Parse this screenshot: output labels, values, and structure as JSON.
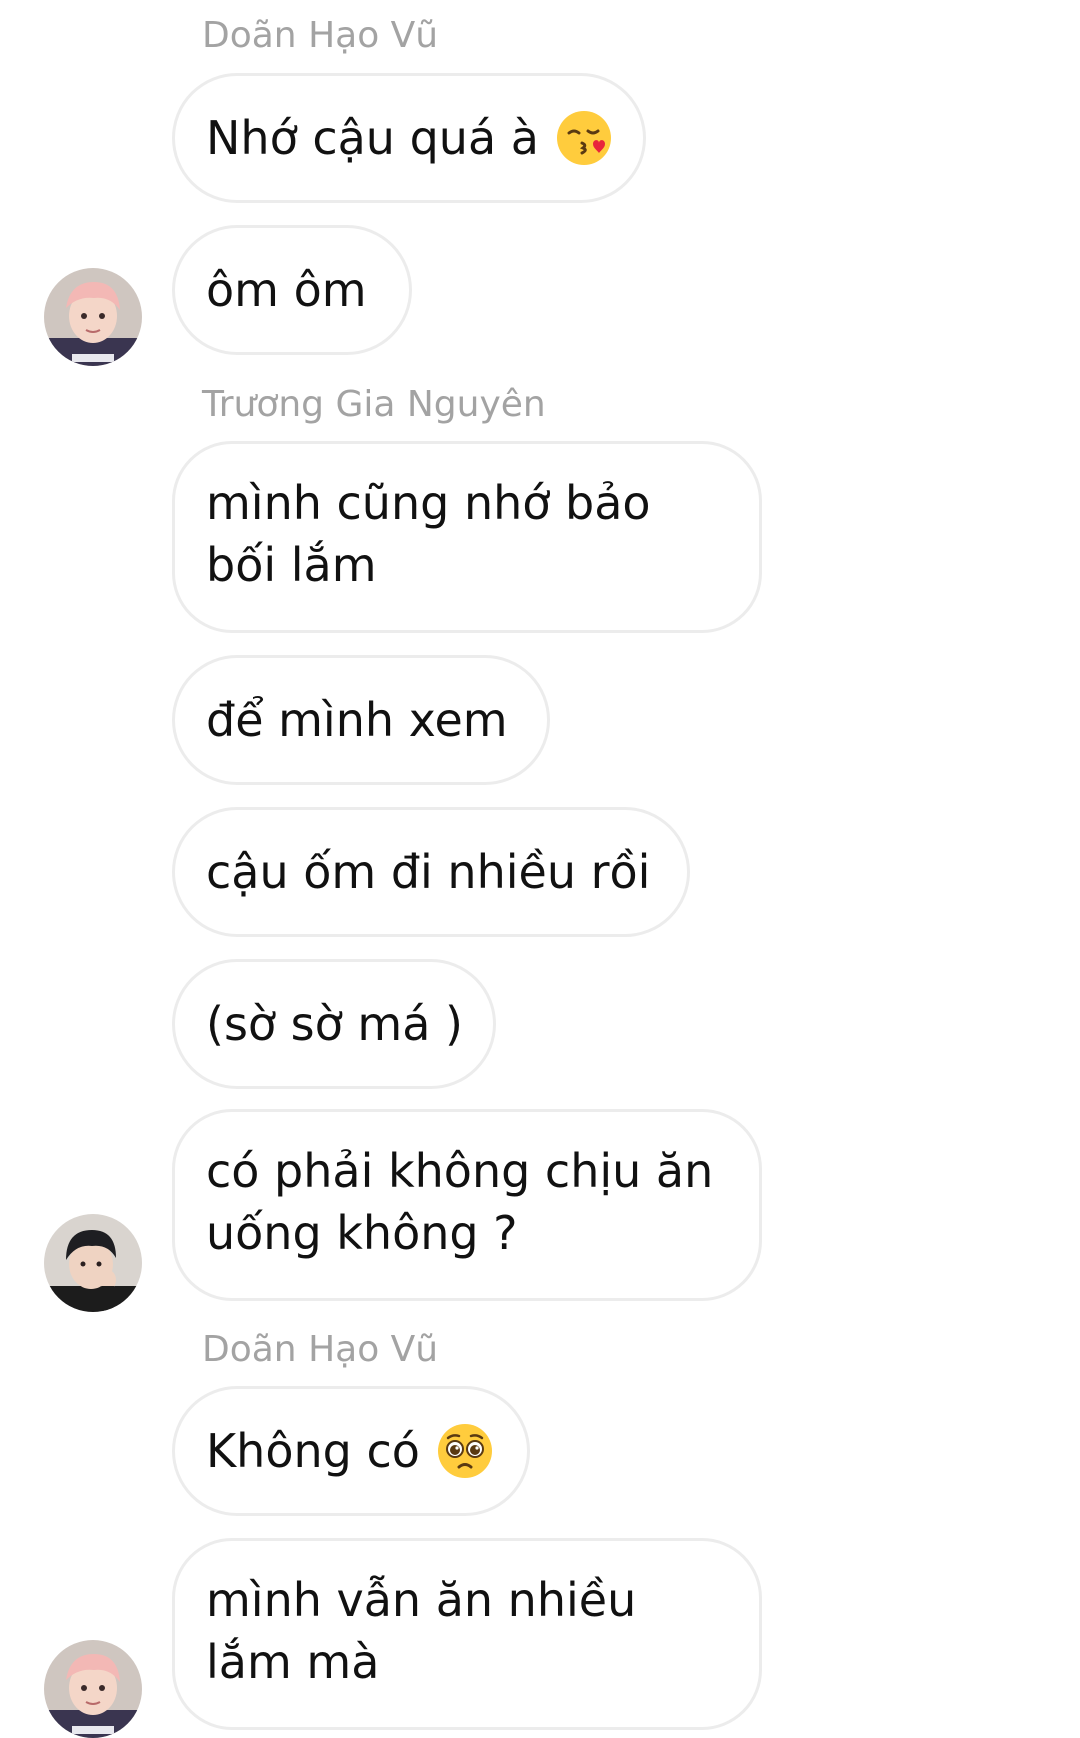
{
  "thread": {
    "messages": [
      {
        "sender": "Doãn Hạo Vũ",
        "text": "Nhớ cậu quá à",
        "emoji": "kissing-face-with-heart-icon"
      },
      {
        "sender": "Doãn Hạo Vũ",
        "text": "ôm ôm"
      },
      {
        "sender": "Trương Gia Nguyên",
        "text": "mình cũng nhớ bảo bối lắm"
      },
      {
        "sender": "Trương Gia Nguyên",
        "text": "để mình xem"
      },
      {
        "sender": "Trương Gia Nguyên",
        "text": "cậu ốm đi nhiều rồi"
      },
      {
        "sender": "Trương Gia Nguyên",
        "text": "(sờ sờ má )"
      },
      {
        "sender": "Trương Gia Nguyên",
        "text": "có phải không chịu ăn uống không ?"
      },
      {
        "sender": "Doãn Hạo Vũ",
        "text": "Không có",
        "emoji": "pleading-face-icon"
      },
      {
        "sender": "Doãn Hạo Vũ",
        "text": "mình vẫn ăn nhiều lắm mà"
      }
    ],
    "sender_names": [
      "Doãn Hạo Vũ",
      "Trương Gia Nguyên",
      "Doãn Hạo Vũ"
    ]
  },
  "colors": {
    "background": "#ffffff",
    "bubble_border": "#ececec",
    "message_text": "#111111",
    "sender_name": "#a3a3a3"
  }
}
